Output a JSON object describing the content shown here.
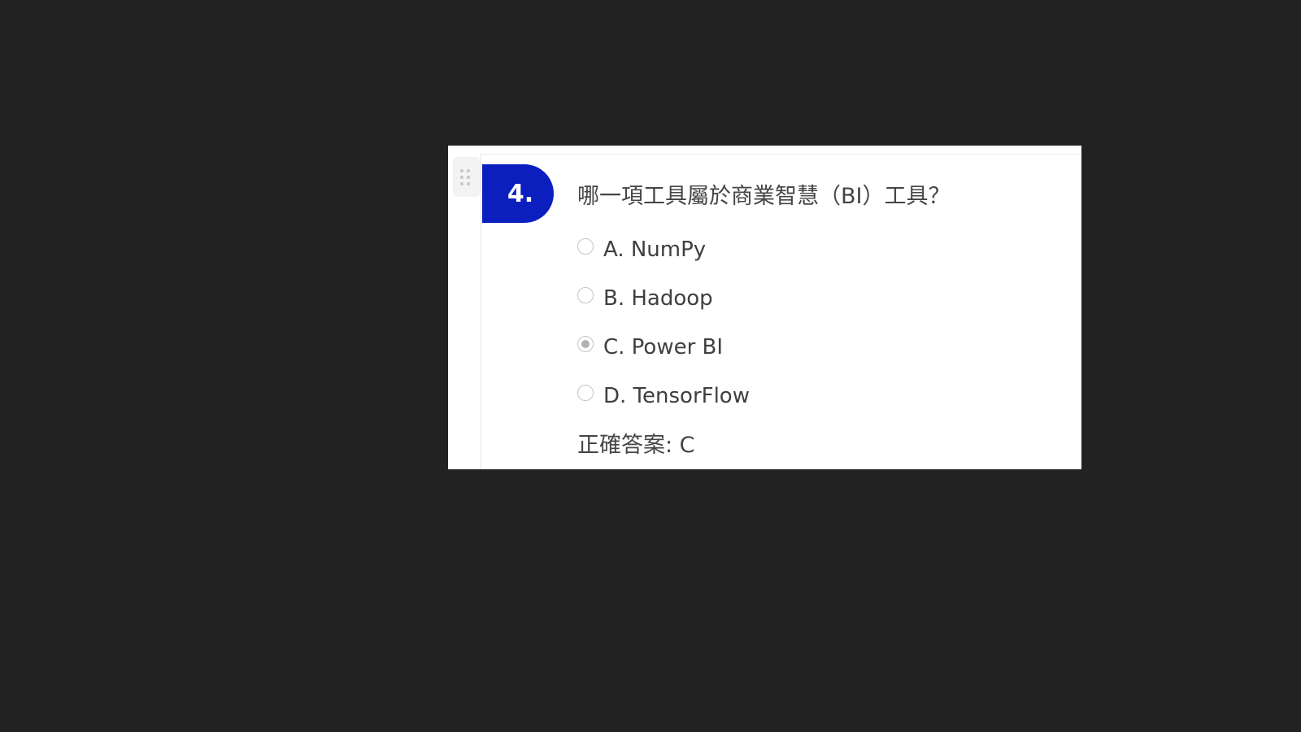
{
  "question": {
    "number": "4.",
    "text": "哪一項工具屬於商業智慧（BI）工具？",
    "options": [
      {
        "label": "A. NumPy",
        "selected": false
      },
      {
        "label": "B. Hadoop",
        "selected": false
      },
      {
        "label": "C. Power BI",
        "selected": true
      },
      {
        "label": "D. TensorFlow",
        "selected": false
      }
    ],
    "answer": "正確答案: C"
  },
  "colors": {
    "background": "#222222",
    "card": "#ffffff",
    "number_badge": "#0b1fbf",
    "text": "#454545"
  },
  "icons": {
    "drag_handle": "drag-dots-icon"
  }
}
